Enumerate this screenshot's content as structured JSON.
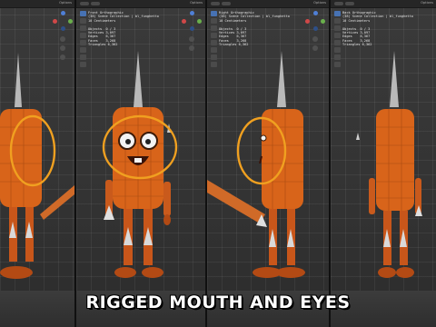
{
  "caption": "RIGGED MOUTH AND EYES",
  "viewports": [
    {
      "title": "",
      "options_label": "Options",
      "stats": []
    },
    {
      "title": "Front Orthographic",
      "collection": "(38) Scene Collection | bl_funghetto",
      "units": "10 Centimeters",
      "options_label": "Options",
      "stats": [
        {
          "label": "Objects",
          "value": "0 / 3"
        },
        {
          "label": "Vertices",
          "value": "3,097"
        },
        {
          "label": "Edges",
          "value": "6,367"
        },
        {
          "label": "Faces",
          "value": "3,268"
        },
        {
          "label": "Triangles",
          "value": "6,362"
        }
      ]
    },
    {
      "title": "Right Orthographic",
      "collection": "(38) Scene Collection | bl_funghetto",
      "units": "10 Centimeters",
      "options_label": "Options",
      "stats": [
        {
          "label": "Objects",
          "value": "0 / 3"
        },
        {
          "label": "Vertices",
          "value": "3,097"
        },
        {
          "label": "Edges",
          "value": "6,367"
        },
        {
          "label": "Faces",
          "value": "3,268"
        },
        {
          "label": "Triangles",
          "value": "6,362"
        }
      ]
    },
    {
      "title": "Back Orthographic",
      "collection": "(38) Scene Collection | bl_funghetto",
      "units": "10 Centimeters",
      "options_label": "Options",
      "stats": [
        {
          "label": "Objects",
          "value": "0 / 3"
        },
        {
          "label": "Vertices",
          "value": "3,097"
        },
        {
          "label": "Edges",
          "value": "6,367"
        },
        {
          "label": "Faces",
          "value": "3,268"
        },
        {
          "label": "Triangles",
          "value": "6,362"
        }
      ]
    }
  ],
  "colors": {
    "body_orange": "#d8641a",
    "highlight_circle": "#f0a020",
    "bone_gray": "#b9b9b9",
    "accent_blue": "#4772b3"
  }
}
